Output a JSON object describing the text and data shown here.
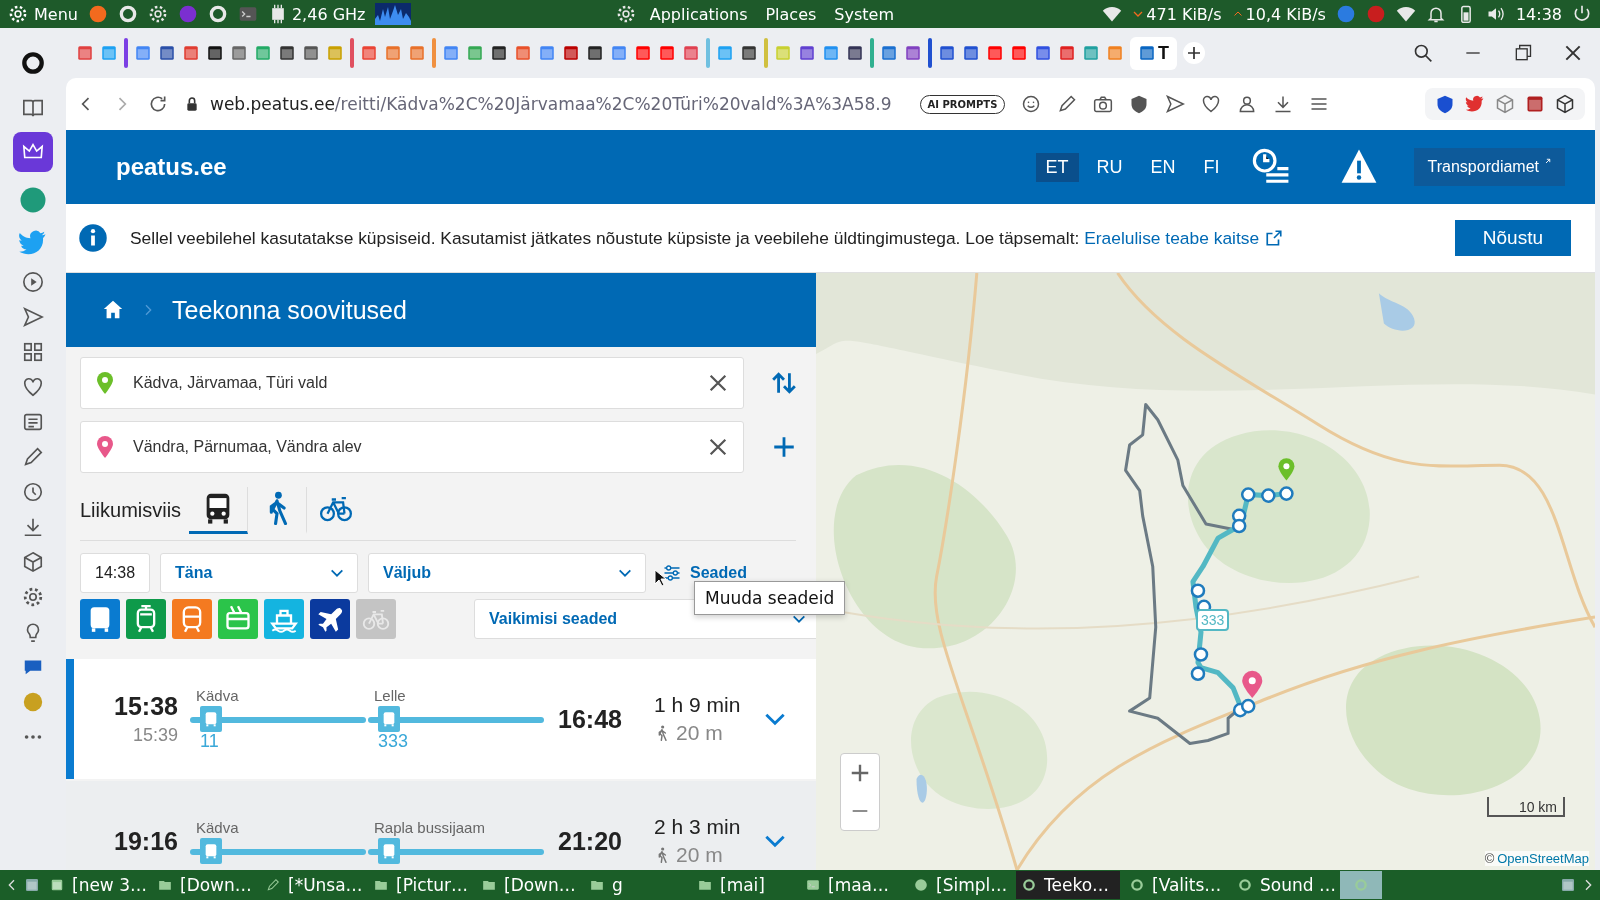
{
  "system_panel": {
    "menu": "Menu",
    "cpu": "2,46 GHz",
    "menus": [
      "Applications",
      "Places",
      "System"
    ],
    "net_down": "471 KiB/s",
    "net_up": "10,4 KiB/s",
    "clock": "14:38"
  },
  "browser": {
    "active_tab_label": "T",
    "url_host": "web.peatus.ee",
    "url_path": "/reitti/Kädva%2C%20Järvamaa%2C%20Türi%20vald%3A%3A58.9",
    "ai_button": "AI PROMPTS"
  },
  "header": {
    "logo": "peatus.ee",
    "languages": [
      {
        "label": "ET",
        "selected": true
      },
      {
        "label": "RU",
        "selected": false
      },
      {
        "label": "EN",
        "selected": false
      },
      {
        "label": "FI",
        "selected": false
      }
    ],
    "agency_link": "Transpordiamet"
  },
  "cookie_banner": {
    "text": "Sellel veebilehel kasutatakse küpsiseid. Kasutamist jätkates nõustute küpsiste ja veebilehe üldtingimustega. Loe täpsemalt:",
    "link": "Eraelulise teabe kaitse",
    "button": "Nõustu"
  },
  "panel": {
    "title": "Teekonna soovitused",
    "from": "Kädva, Järvamaa, Türi vald",
    "to": "Vändra, Pärnumaa, Vändra alev",
    "mode_label": "Liikumisviis",
    "modes": [
      {
        "kind": "bus",
        "selected": true
      },
      {
        "kind": "walk",
        "selected": false
      },
      {
        "kind": "bike",
        "selected": false
      }
    ],
    "time": "14:38",
    "day": "Täna",
    "time_type": "Väljub",
    "settings_link": "Seaded",
    "tooltip": "Muuda seadeid",
    "vehicle_filters": [
      {
        "kind": "bus",
        "on": true
      },
      {
        "kind": "tram",
        "on": true
      },
      {
        "kind": "train",
        "on": true
      },
      {
        "kind": "trolley",
        "on": true
      },
      {
        "kind": "ferry",
        "on": true
      },
      {
        "kind": "plane",
        "on": true
      },
      {
        "kind": "bike",
        "on": false
      }
    ],
    "preset": "Vaikimisi seaded"
  },
  "itineraries": [
    {
      "selected": true,
      "depart": "15:38",
      "realtime": "15:39",
      "arrive": "16:48",
      "duration": "1 h 9 min",
      "walk": "20 m",
      "legs": [
        {
          "stop": "Kädva",
          "line": "11"
        },
        {
          "stop": "Lelle",
          "line": "333"
        }
      ]
    },
    {
      "selected": false,
      "depart": "19:16",
      "arrive": "21:20",
      "duration": "2 h 3 min",
      "walk": "20 m",
      "legs": [
        {
          "stop": "Kädva"
        },
        {
          "stop": "Rapla bussijaam"
        }
      ]
    }
  ],
  "map": {
    "route_label": "333",
    "scale": "10 km",
    "attribution_prefix": "©",
    "attribution_link": "OpenStreetMap"
  },
  "taskbar": [
    {
      "label": "[new 3…",
      "active": false
    },
    {
      "label": "[Down…",
      "active": false
    },
    {
      "label": "[*Unsa…",
      "active": false
    },
    {
      "label": "[Pictur…",
      "active": false
    },
    {
      "label": "[Down…",
      "active": false
    },
    {
      "label": "g",
      "active": false
    },
    {
      "label": "[mai]",
      "active": false
    },
    {
      "label": "[maa…",
      "active": false
    },
    {
      "label": "[Simpl…",
      "active": false
    },
    {
      "label": "Teeko…",
      "active": true
    },
    {
      "label": "[Valits…",
      "active": false
    },
    {
      "label": "Sound …",
      "active": false
    }
  ]
}
